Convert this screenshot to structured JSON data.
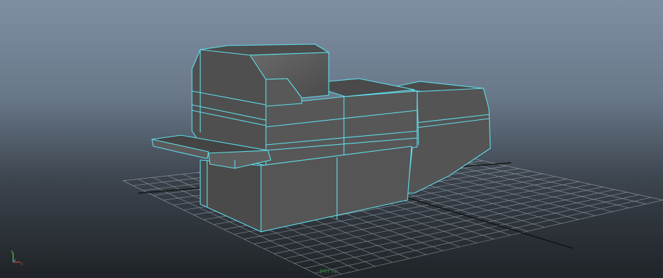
{
  "viewport": {
    "camera_label": "persp",
    "colors": {
      "background_top": "#7f8fa2",
      "background_bottom": "#1f2327",
      "grid": "#c4c9cf",
      "grid_axis": "#111111",
      "mesh_face": "#525252",
      "mesh_wire": "#5ee0ee"
    },
    "axis_gizmo": {
      "x_color": "#e0463c",
      "y_color": "#5ed14a",
      "z_color": "#4a74e0"
    }
  }
}
